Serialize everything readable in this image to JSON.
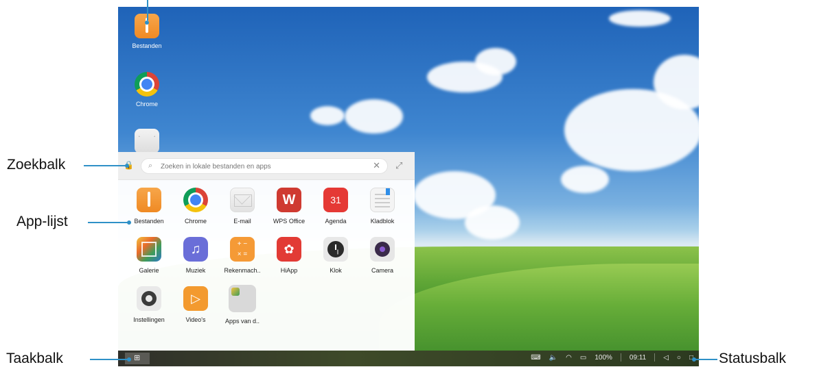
{
  "desktop": {
    "icons": [
      {
        "label": "Bestanden",
        "icon": "files-icon"
      },
      {
        "label": "Chrome",
        "icon": "chrome-icon"
      },
      {
        "label": "",
        "icon": "email-icon"
      }
    ]
  },
  "launcher": {
    "search_placeholder": "Zoeken in lokale bestanden en apps",
    "search_glyph": "⌕",
    "clear_glyph": "✕",
    "expand_glyph": "⤢",
    "lock_glyph": "🔒",
    "apps": [
      {
        "label": "Bestanden",
        "icon": "files-icon"
      },
      {
        "label": "Chrome",
        "icon": "chrome-icon"
      },
      {
        "label": "E-mail",
        "icon": "email-icon"
      },
      {
        "label": "WPS Office",
        "icon": "wps-office-icon",
        "glyph": "W"
      },
      {
        "label": "Agenda",
        "icon": "calendar-icon",
        "glyph": "31"
      },
      {
        "label": "Kladblok",
        "icon": "notepad-icon"
      },
      {
        "label": "Galerie",
        "icon": "gallery-icon"
      },
      {
        "label": "Muziek",
        "icon": "music-icon",
        "glyph": "♫"
      },
      {
        "label": "Rekenmach..",
        "icon": "calculator-icon",
        "glyph": "+ −\n× ="
      },
      {
        "label": "HiApp",
        "icon": "hiapp-icon",
        "glyph": "✿"
      },
      {
        "label": "Klok",
        "icon": "clock-icon"
      },
      {
        "label": "Camera",
        "icon": "camera-icon"
      },
      {
        "label": "Instellingen",
        "icon": "settings-icon"
      },
      {
        "label": "Video's",
        "icon": "video-icon",
        "glyph": "▷"
      },
      {
        "label": "Apps van d..",
        "icon": "folder-icon"
      }
    ]
  },
  "taskbar": {
    "start_glyph": "⊞",
    "battery": "100%",
    "time": "09:11",
    "icons": {
      "keyboard": "⌨",
      "volume": "🔈",
      "wifi": "◠",
      "battery": "▭",
      "back": "◁",
      "home": "○",
      "recents": "□"
    }
  },
  "annotations": {
    "search": "Zoekbalk",
    "applist": "App-lijst",
    "taskbar": "Taakbalk",
    "statusbar": "Statusbalk"
  },
  "colors": {
    "accent_line": "#2e90c7",
    "launcher_bg": "#ffffff",
    "taskbar_bg": "#2f2f2a"
  }
}
